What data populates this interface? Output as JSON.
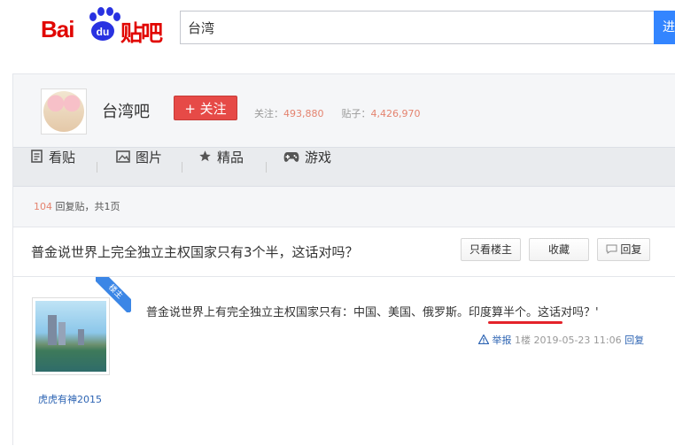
{
  "header": {
    "logo_bai": "Bai",
    "logo_du": "du",
    "logo_tieba": "贴吧",
    "search_value": "台湾",
    "search_button": "进"
  },
  "forum": {
    "name": "台湾吧",
    "follow_label": "+ 关注",
    "followers_label": "关注：",
    "followers_value": "493,880",
    "posts_label": "贴子：",
    "posts_value": "4,426,970"
  },
  "tabs": [
    {
      "label": "看贴",
      "icon": "document-icon"
    },
    {
      "label": "图片",
      "icon": "image-icon"
    },
    {
      "label": "精品",
      "icon": "star-icon"
    },
    {
      "label": "游戏",
      "icon": "gamepad-icon"
    }
  ],
  "reply_summary": {
    "count": "104",
    "text": " 回复贴，共1页"
  },
  "thread": {
    "title": "普金说世界上完全独立主权国家只有3个半，这话对吗？",
    "only_op_label": "只看楼主",
    "favorite_label": "收藏",
    "reply_label": "回复"
  },
  "post": {
    "badge": "楼主",
    "author": "虎虎有神2015",
    "body": "普金说世界上有完全独立主权国家只有：中国、美国、俄罗斯。印度算半个。这话对吗？'",
    "report_label": "举报",
    "floor": "1楼",
    "datetime": "2019-05-23 11:06",
    "reply_label": "回复"
  }
}
